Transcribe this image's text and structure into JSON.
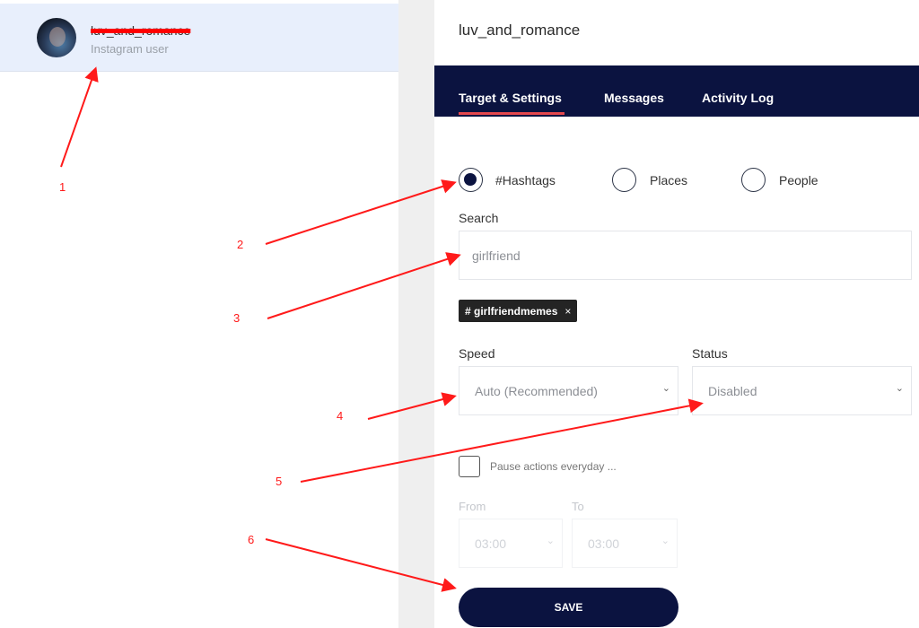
{
  "account": {
    "name": "luv_and_romance",
    "subtitle": "Instagram user"
  },
  "panel": {
    "title": "luv_and_romance"
  },
  "tabs": [
    {
      "label": "Target & Settings",
      "active": true
    },
    {
      "label": "Messages",
      "active": false
    },
    {
      "label": "Activity Log",
      "active": false
    }
  ],
  "target_type": {
    "options": [
      "#Hashtags",
      "Places",
      "People"
    ],
    "selected": "#Hashtags"
  },
  "search": {
    "label": "Search",
    "value": "girlfriend"
  },
  "tags": [
    {
      "label": "# girlfriendmemes",
      "close": "×"
    }
  ],
  "speed": {
    "label": "Speed",
    "value": "Auto (Recommended)"
  },
  "status": {
    "label": "Status",
    "value": "Disabled"
  },
  "pause": {
    "label": "Pause actions everyday ...",
    "checked": false
  },
  "schedule": {
    "from_label": "From",
    "from_value": "03:00",
    "to_label": "To",
    "to_value": "03:00"
  },
  "save_label": "SAVE",
  "annotations": [
    "1",
    "2",
    "3",
    "4",
    "5",
    "6"
  ],
  "colors": {
    "navy": "#0b1340",
    "accent": "#e5484d",
    "annotation": "#ff1a1a",
    "selected_row": "#e8effc"
  }
}
